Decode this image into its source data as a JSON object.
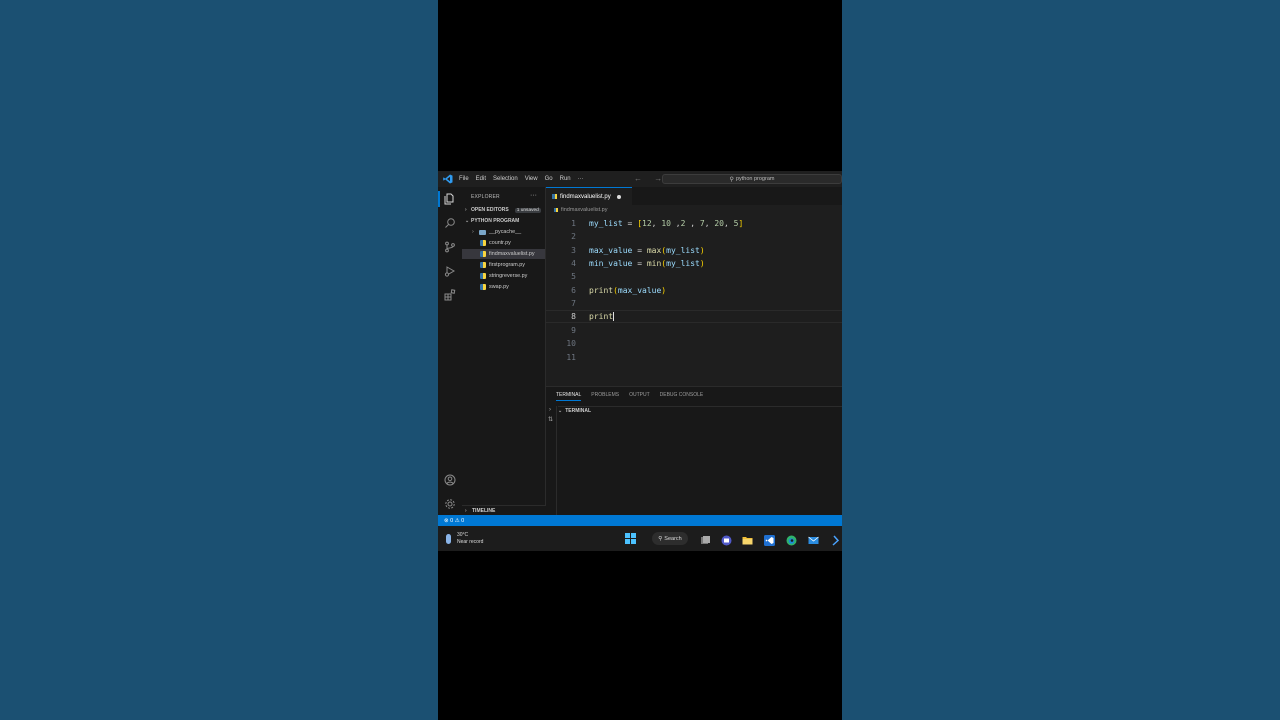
{
  "titlebar": {
    "menu": [
      "File",
      "Edit",
      "Selection",
      "View",
      "Go",
      "Run",
      "···"
    ],
    "nav_arrows": "← →",
    "search_text": "python program"
  },
  "sidebar": {
    "title": "EXPLORER",
    "more": "···",
    "open_editors_label": "OPEN EDITORS",
    "open_editors_badge": "1 unsaved",
    "folder_label": "PYTHON PROGRAM",
    "files": [
      {
        "name": "__pycache__",
        "type": "folder"
      },
      {
        "name": "countr.py",
        "type": "py"
      },
      {
        "name": "findmaxvaluelist.py",
        "type": "py",
        "selected": true
      },
      {
        "name": "firstprogram.py",
        "type": "py"
      },
      {
        "name": "stringreverse.py",
        "type": "py"
      },
      {
        "name": "swap.py",
        "type": "py"
      }
    ],
    "timeline_label": "TIMELINE"
  },
  "editor": {
    "tab_label": "findmaxvaluelist.py",
    "breadcrumb": "findmaxvaluelist.py",
    "line_numbers": [
      "1",
      "2",
      "3",
      "4",
      "5",
      "6",
      "7",
      "8",
      "9",
      "10",
      "11"
    ],
    "current_line": 8,
    "lines": [
      "my_list = [12, 10 ,2 , 7, 20, 5]",
      "",
      "max_value = max(my_list)",
      "min_value = min(my_list)",
      "",
      "print(max_value)",
      "",
      "print",
      "",
      "",
      ""
    ]
  },
  "panel": {
    "tabs": [
      "TERMINAL",
      "PROBLEMS",
      "OUTPUT",
      "DEBUG CONSOLE"
    ],
    "active_tab": "TERMINAL",
    "terminal_header": "TERMINAL"
  },
  "statusbar": {
    "text": "⊗ 0 ⚠ 0"
  },
  "taskbar": {
    "temperature": "30°C",
    "weather_note": "Near record",
    "search_label": "Search"
  },
  "colors": {
    "accent": "#0078d4",
    "background": "#1b5072",
    "editor_bg": "#1e1e1e"
  }
}
